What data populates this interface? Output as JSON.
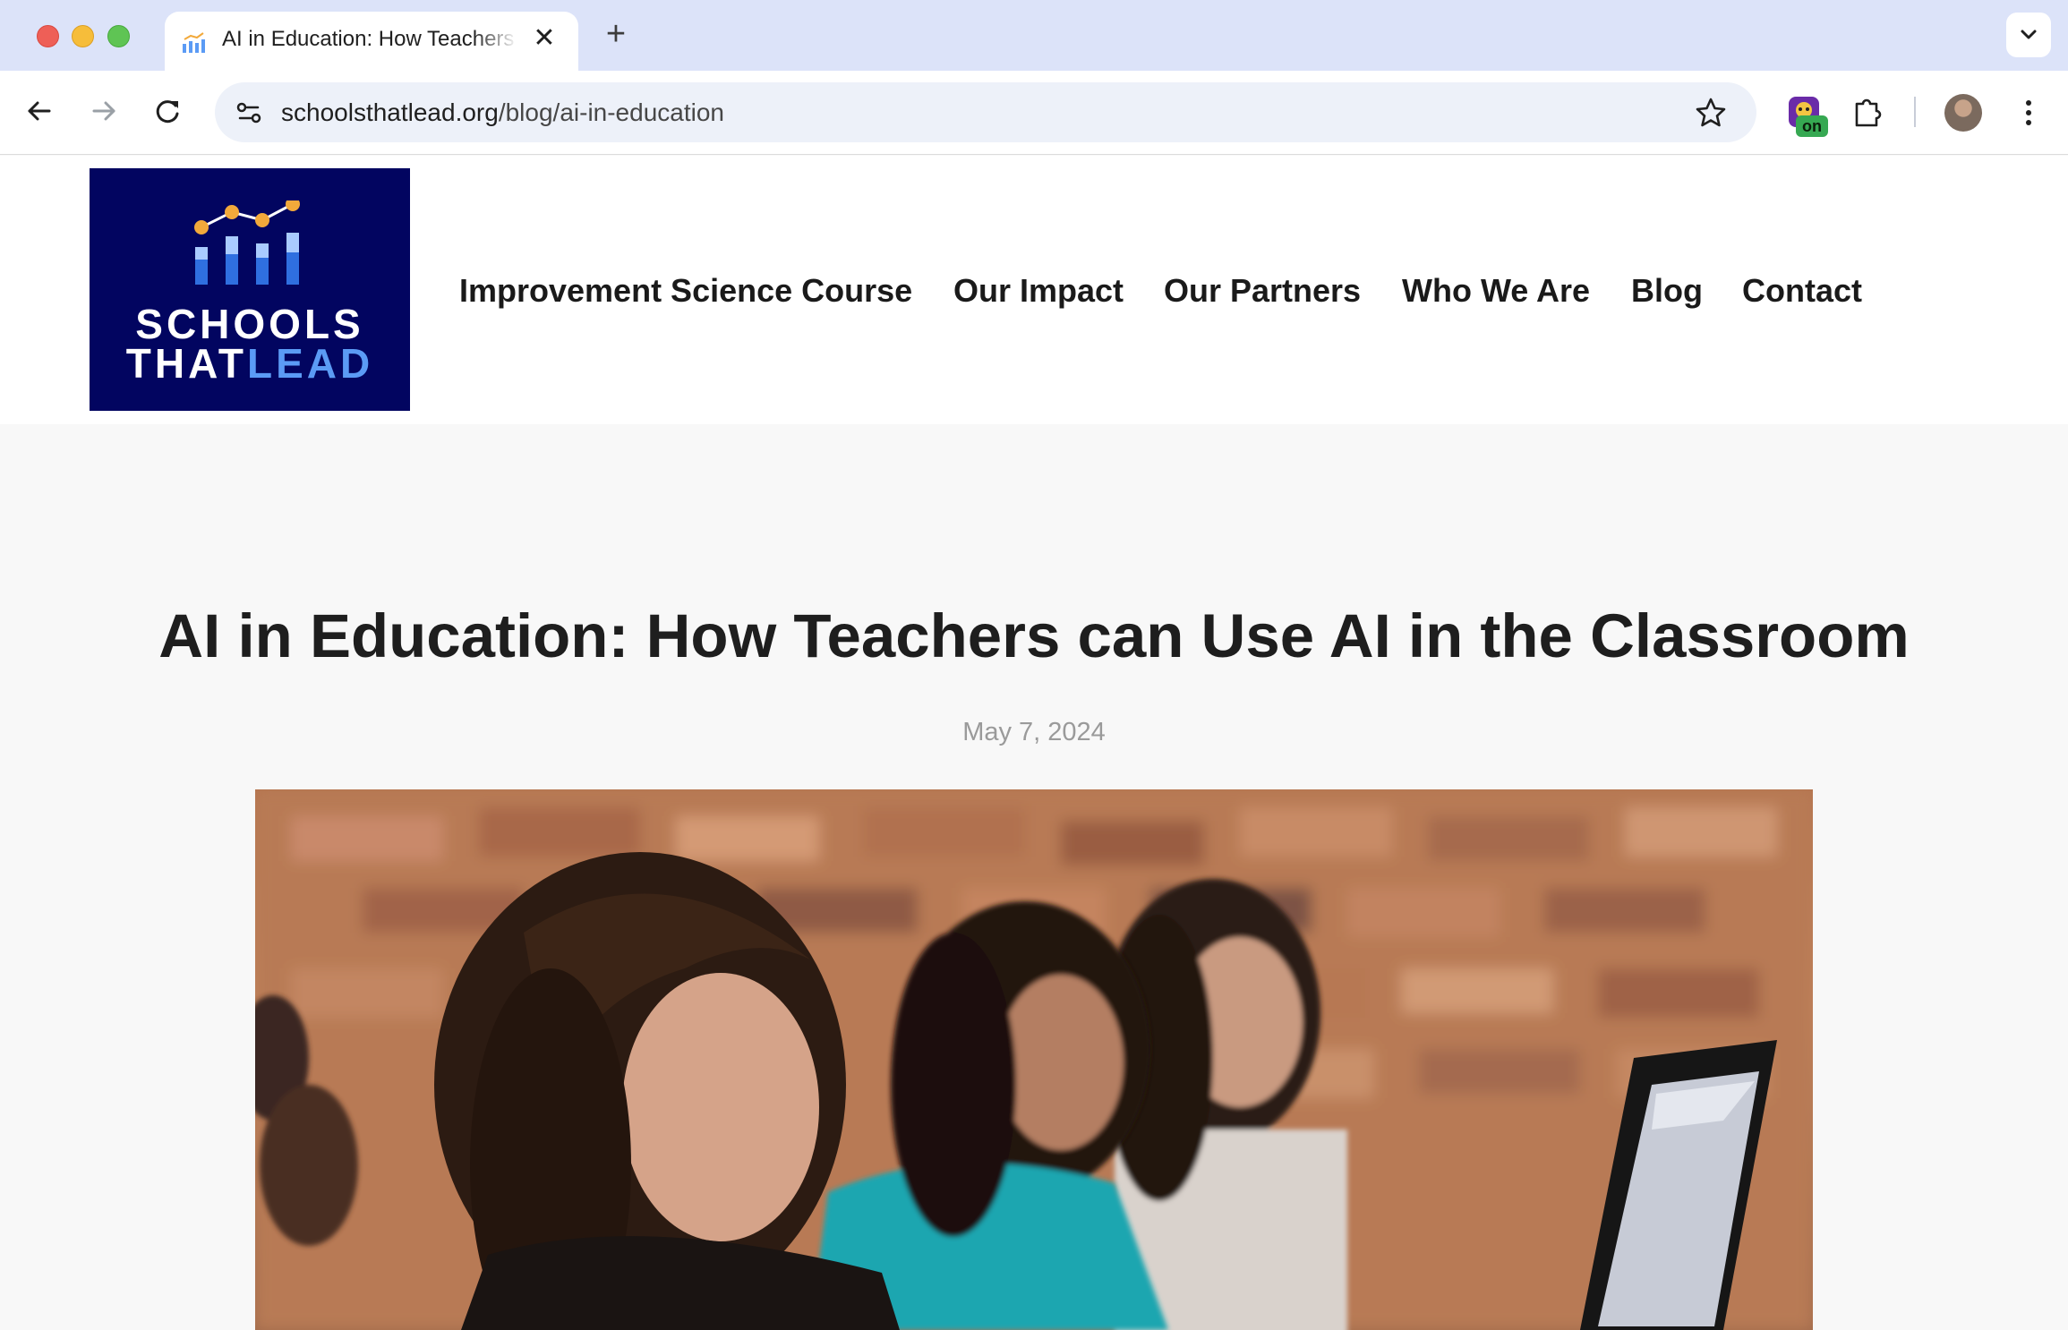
{
  "browser": {
    "tab_title": "AI in Education: How Teachers can Use AI in the Classroom",
    "tab_close_glyph": "✕",
    "new_tab_glyph": "+",
    "url_domain": "schoolsthatlead.org",
    "url_path": "/blog/ai-in-education",
    "extension_badge": "on"
  },
  "site": {
    "logo_line1": "SCHOOLS",
    "logo_line2_a": "THAT",
    "logo_line2_b": "LEAD",
    "brand_color": "#020560",
    "accent_color": "#5b9bf5",
    "nav": [
      {
        "label": "Improvement Science Course"
      },
      {
        "label": "Our Impact"
      },
      {
        "label": "Our Partners"
      },
      {
        "label": "Who We Are"
      },
      {
        "label": "Blog"
      },
      {
        "label": "Contact"
      }
    ]
  },
  "article": {
    "title": "AI in Education: How Teachers can Use AI in the Classroom",
    "date": "May 7, 2024",
    "hero_image": "students-at-laptops-photo"
  }
}
